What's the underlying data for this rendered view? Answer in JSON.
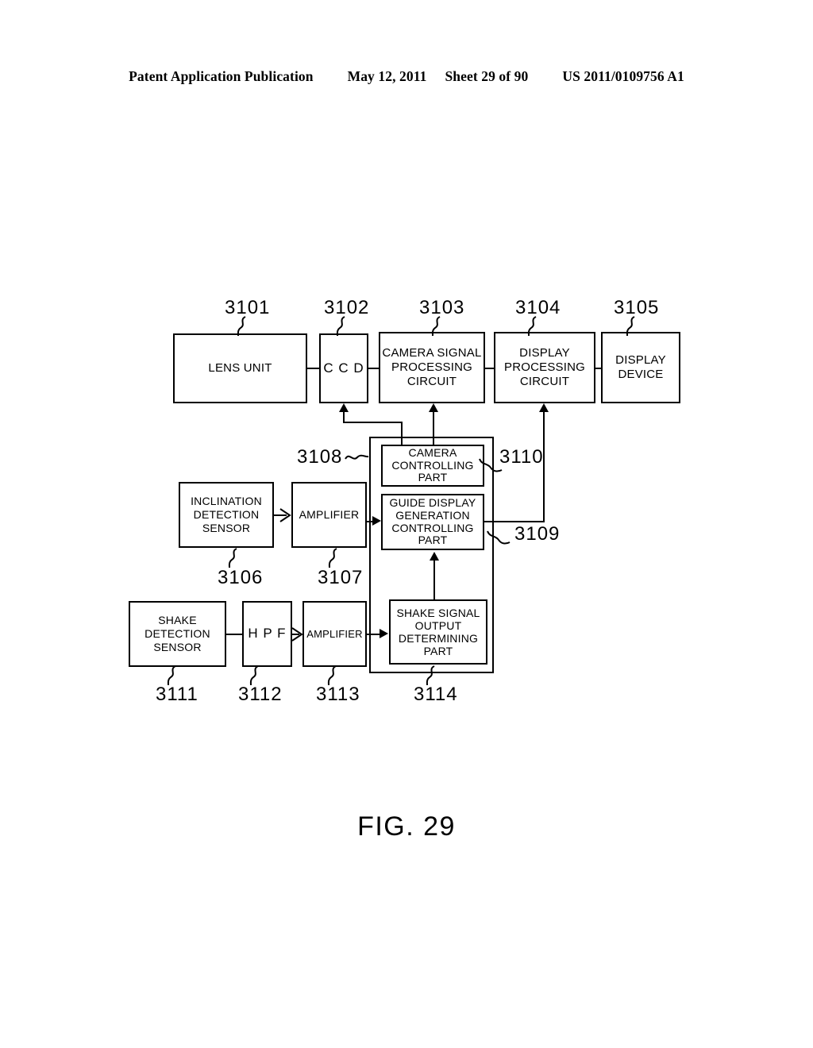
{
  "header": {
    "publication": "Patent Application Publication",
    "date": "May 12, 2011",
    "sheet": "Sheet 29 of 90",
    "number": "US 2011/0109756 A1"
  },
  "figure": {
    "caption": "FIG. 29",
    "blocks": [
      {
        "id": "lens-unit",
        "ref": "3101",
        "lines": [
          "LENS UNIT"
        ]
      },
      {
        "id": "ccd",
        "ref": "3102",
        "lines": [
          "C C D"
        ]
      },
      {
        "id": "camera-signal-processing-circuit",
        "ref": "3103",
        "lines": [
          "CAMERA SIGNAL",
          "PROCESSING",
          "CIRCUIT"
        ]
      },
      {
        "id": "display-processing-circuit",
        "ref": "3104",
        "lines": [
          "DISPLAY",
          "PROCESSING",
          "CIRCUIT"
        ]
      },
      {
        "id": "display-device",
        "ref": "3105",
        "lines": [
          "DISPLAY",
          "DEVICE"
        ]
      },
      {
        "id": "inclination-detection-sensor",
        "ref": "3106",
        "lines": [
          "INCLINATION",
          "DETECTION",
          "SENSOR"
        ]
      },
      {
        "id": "inclination-amplifier",
        "ref": "3107",
        "lines": [
          "AMPLIFIER"
        ]
      },
      {
        "id": "controller-group",
        "ref": "3108",
        "lines": []
      },
      {
        "id": "guide-display-generation-controlling-part",
        "ref": "3109",
        "lines": [
          "GUIDE DISPLAY",
          "GENERATION",
          "CONTROLLING",
          "PART"
        ]
      },
      {
        "id": "camera-controlling-part",
        "ref": "3110",
        "lines": [
          "CAMERA",
          "CONTROLLING",
          "PART"
        ]
      },
      {
        "id": "shake-detection-sensor",
        "ref": "3111",
        "lines": [
          "SHAKE",
          "DETECTION",
          "SENSOR"
        ]
      },
      {
        "id": "hpf",
        "ref": "3112",
        "lines": [
          "H P F"
        ]
      },
      {
        "id": "shake-amplifier",
        "ref": "3113",
        "lines": [
          "AMPLIFIER"
        ]
      },
      {
        "id": "shake-signal-output-determining-part",
        "ref": "3114",
        "lines": [
          "SHAKE SIGNAL",
          "OUTPUT",
          "DETERMINING",
          "PART"
        ]
      }
    ],
    "refs": {
      "r3101": "3101",
      "r3102": "3102",
      "r3103": "3103",
      "r3104": "3104",
      "r3105": "3105",
      "r3106": "3106",
      "r3107": "3107",
      "r3108": "3108",
      "r3109": "3109",
      "r3110": "3110",
      "r3111": "3111",
      "r3112": "3112",
      "r3113": "3113",
      "r3114": "3114"
    },
    "labels": {
      "lens_unit": "LENS UNIT",
      "ccd": "C C D",
      "csp_1": "CAMERA SIGNAL",
      "csp_2": "PROCESSING",
      "csp_3": "CIRCUIT",
      "dpc_1": "DISPLAY",
      "dpc_2": "PROCESSING",
      "dpc_3": "CIRCUIT",
      "dd_1": "DISPLAY",
      "dd_2": "DEVICE",
      "ids_1": "INCLINATION",
      "ids_2": "DETECTION",
      "ids_3": "SENSOR",
      "amp_incl": "AMPLIFIER",
      "ccp_1": "CAMERA",
      "ccp_2": "CONTROLLING",
      "ccp_3": "PART",
      "gdg_1": "GUIDE DISPLAY",
      "gdg_2": "GENERATION",
      "gdg_3": "CONTROLLING",
      "gdg_4": "PART",
      "sds_1": "SHAKE",
      "sds_2": "DETECTION",
      "sds_3": "SENSOR",
      "hpf": "H P F",
      "amp_shake": "AMPLIFIER",
      "ssod_1": "SHAKE SIGNAL",
      "ssod_2": "OUTPUT",
      "ssod_3": "DETERMINING",
      "ssod_4": "PART"
    }
  },
  "colors": {
    "ink": "#000000",
    "paper": "#ffffff"
  }
}
